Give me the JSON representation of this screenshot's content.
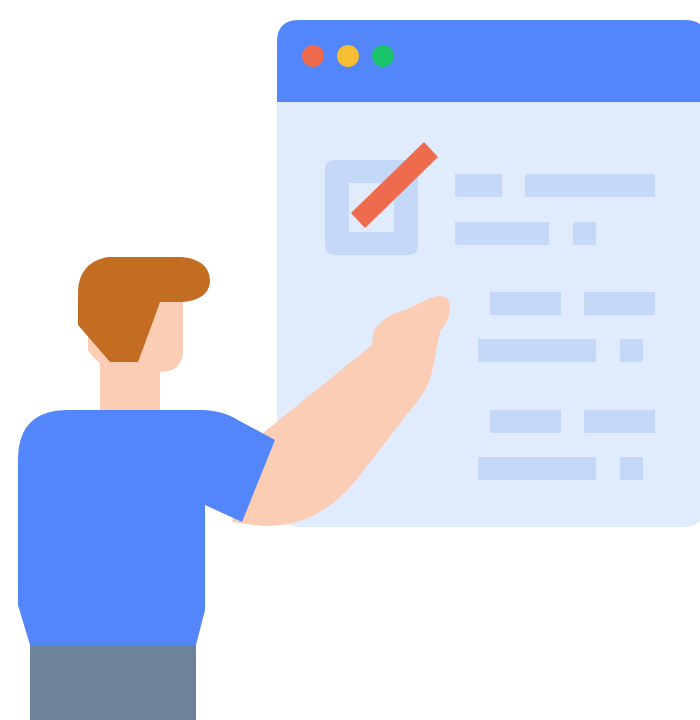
{
  "illustration": {
    "subject": "person-pointing-at-checklist-window",
    "colors": {
      "window_header": "#5386FB",
      "window_body": "#E0EBFD",
      "placeholder": "#C5D8F8",
      "dot_red": "#EF6B4D",
      "dot_yellow": "#F8BE33",
      "dot_green": "#19C46A",
      "check_mark": "#EF6B4D",
      "skin": "#FBCDB5",
      "hair": "#C26D22",
      "shirt": "#5386FB",
      "pants": "#6D8498"
    }
  }
}
